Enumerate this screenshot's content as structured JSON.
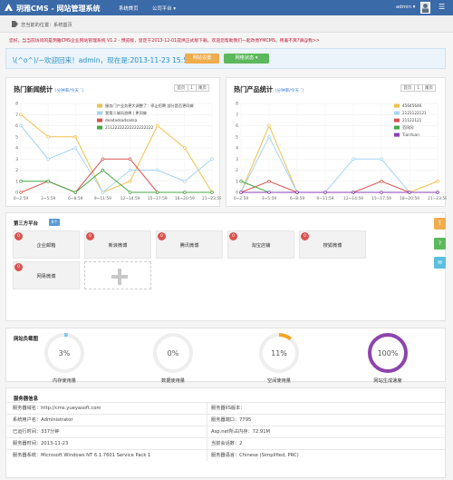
{
  "topbar": {
    "brand": "玥雅CMS - 网站管理系统",
    "nav_home": "系统首页",
    "nav_platform": "公司平台 ▾",
    "user": "admin ▾",
    "menu_icon": "hamburger-icon",
    "logo_icon": "logo-icon"
  },
  "crumb": {
    "label": "您当前的位置：",
    "current": "系统首页"
  },
  "notice": "您好，当当前访问的是玥雅CMS企业网站管理系统 V1.2 - 预览版，登定于2013-12-01提供正式版下载。欢迎您帮助我们一起改善YMCMS，用着不爽?请@我>>",
  "welcome": {
    "text": "\\(^o^)/~欢迎回来！admin，现在是:2013-11-23 15:56",
    "btn_site": "网站设置",
    "btn_status": "网络状态 ▾"
  },
  "news": {
    "title": "热门新闻统计",
    "subtitle": "(分钟率/今天 ˇ)",
    "pager_first": "首页",
    "pager_cur": "1",
    "pager_last": "尾页"
  },
  "products": {
    "title": "热门产品统计",
    "subtitle": "(分钟率/今天 ˇ)",
    "pager_first": "首页",
    "pager_cur": "1",
    "pager_last": "尾页"
  },
  "chart_data": [
    {
      "type": "line",
      "categories": [
        "0~2:59",
        "3~5:59",
        "6~8:59",
        "9~11:59",
        "12~14:59",
        "15~17:59",
        "18~20:59",
        "21~23:59"
      ],
      "ylim": [
        0,
        8
      ],
      "yticks": [
        0,
        1,
        2,
        3,
        4,
        5,
        6,
        7,
        8
      ],
      "grid": true,
      "legend": "top-right",
      "series": [
        {
          "name": "服务门户业务更大调整了：停止招聘 部分是否更同做",
          "color": "#f0c04c",
          "values": [
            7,
            5,
            5,
            0,
            1,
            6,
            4,
            0
          ]
        },
        {
          "name": "我第二城风浪降 | 更同做",
          "color": "#a6d4f1",
          "values": [
            6,
            3,
            4,
            0,
            2,
            2,
            1,
            3
          ]
        },
        {
          "name": "deadadsadsadsa",
          "color": "#d9534f",
          "values": [
            0,
            1,
            0,
            3,
            3,
            0,
            0,
            0
          ]
        },
        {
          "name": "21122222222222222222",
          "color": "#45a845",
          "values": [
            1,
            1,
            0,
            2,
            0,
            0,
            0,
            0
          ]
        }
      ]
    },
    {
      "type": "line",
      "categories": [
        "0~2:59",
        "3~5:59",
        "6~8:59",
        "9~11:59",
        "12~14:59",
        "15~17:59",
        "18~20:59",
        "21~23:59"
      ],
      "ylim": [
        0,
        8
      ],
      "yticks": [
        0,
        1,
        2,
        3,
        4,
        5,
        6,
        7,
        8
      ],
      "grid": true,
      "legend": "top-right",
      "series": [
        {
          "name": "45645646",
          "color": "#f0c04c",
          "values": [
            0,
            6,
            0,
            0,
            0,
            0,
            0,
            1
          ]
        },
        {
          "name": "2121122121",
          "color": "#a6d4f1",
          "values": [
            0,
            5,
            0,
            0,
            3,
            3,
            0,
            0
          ]
        },
        {
          "name": "21122121",
          "color": "#d9534f",
          "values": [
            0,
            1,
            0,
            0,
            0,
            1,
            0,
            0
          ]
        },
        {
          "name": "范冈冈",
          "color": "#45a845",
          "values": [
            1,
            0,
            0,
            0,
            0,
            0,
            0,
            0
          ]
        },
        {
          "name": "TianYuan",
          "color": "#8b3fb8",
          "values": [
            0,
            0,
            0,
            0,
            0,
            0,
            0,
            0
          ]
        }
      ]
    }
  ],
  "apps": {
    "title": "第三方平台",
    "count": "8个",
    "tiles": [
      {
        "label": "企业邮箱",
        "badge": "0"
      },
      {
        "label": "新浪微博",
        "badge": "0"
      },
      {
        "label": "腾讯微博",
        "badge": "0"
      },
      {
        "label": "淘宝店铺",
        "badge": "0"
      },
      {
        "label": "搜狐微博",
        "badge": "0"
      },
      {
        "label": "网易微博",
        "badge": "0"
      }
    ]
  },
  "load": {
    "title": "网站负载图",
    "gauges": [
      {
        "label": "内存使用量",
        "percent": 3,
        "text": "3%",
        "color": "#7ec8ea"
      },
      {
        "label": "数据使用量",
        "percent": 0,
        "text": "0%",
        "color": "#7ec8ea"
      },
      {
        "label": "空间使用量",
        "percent": 11,
        "text": "11%",
        "color": "#f5a623"
      },
      {
        "label": "网站生成速度",
        "percent": 100,
        "text": "100%",
        "color": "#8e44ad"
      }
    ]
  },
  "info": {
    "title": "服务器信息",
    "rows": [
      {
        "left": "服务器域名：http://cms.yueyasoft.com",
        "right": "服务器IIS版本："
      },
      {
        "left": "系统用户名：Administrator",
        "right": "服务器端口：7795"
      },
      {
        "left": "已运行时间：337分钟",
        "right": "Asp.net所占内存：72.91M"
      },
      {
        "left": "服务器时间：2013-11-23",
        "right": "当前会话数：2"
      },
      {
        "left": "服务器系统：Microsoft Windows NT 6.1.7601 Service Pack 1",
        "right": "服务器语言：Chinese (Simplified, PRC)"
      }
    ]
  },
  "side": {
    "top_icon": "back-to-top-icon",
    "help_icon": "question-icon",
    "chat_icon": "chat-icon"
  }
}
